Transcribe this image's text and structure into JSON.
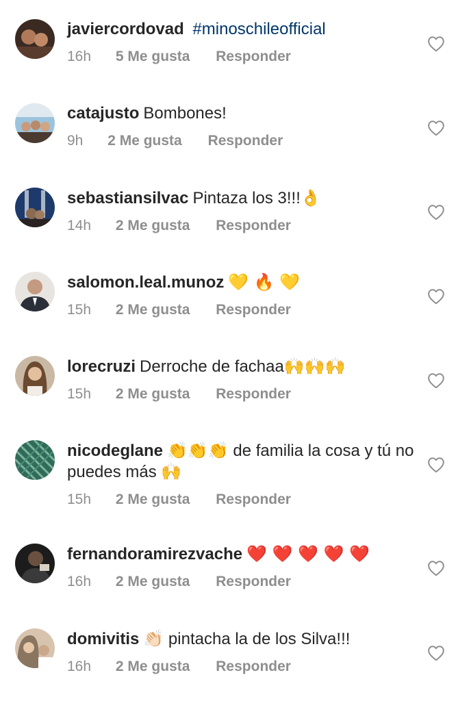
{
  "comments": [
    {
      "username": "javiercordovad",
      "text": "",
      "hashtag": "#minoschileofficial",
      "emoji": "",
      "text2": "",
      "time": "16h",
      "likes": "5 Me gusta",
      "reply": "Responder",
      "avatar_colors": [
        "#3a2a22",
        "#b07a5a"
      ]
    },
    {
      "username": "catajusto",
      "text": "Bombones!",
      "hashtag": "",
      "emoji": "",
      "text2": "",
      "time": "9h",
      "likes": "2 Me gusta",
      "reply": "Responder",
      "avatar_colors": [
        "#6fa6c9",
        "#c99a7c"
      ]
    },
    {
      "username": "sebastiansilvac",
      "text": "Pintaza los 3!!!",
      "hashtag": "",
      "emoji": "👌",
      "text2": "",
      "time": "14h",
      "likes": "2 Me gusta",
      "reply": "Responder",
      "avatar_colors": [
        "#1e3a6b",
        "#8a6a50"
      ]
    },
    {
      "username": "salomon.leal.munoz",
      "text": "",
      "hashtag": "",
      "emoji": "💛 🔥 💛",
      "text2": "",
      "time": "15h",
      "likes": "2 Me gusta",
      "reply": "Responder",
      "avatar_colors": [
        "#e8e4df",
        "#2a2f3a"
      ]
    },
    {
      "username": "lorecruzi",
      "text": "Derroche de fachaa",
      "hashtag": "",
      "emoji": "🙌🙌🙌",
      "text2": "",
      "time": "15h",
      "likes": "2 Me gusta",
      "reply": "Responder",
      "avatar_colors": [
        "#c9b8a4",
        "#6b4a30"
      ]
    },
    {
      "username": "nicodeglane",
      "text": "",
      "hashtag": "",
      "emoji": "👏👏👏",
      "text2": "de familia la cosa y tú no puedes más",
      "emoji2": "🙌",
      "time": "15h",
      "likes": "2 Me gusta",
      "reply": "Responder",
      "avatar_colors": [
        "#2f6b5a",
        "#7fb39a"
      ]
    },
    {
      "username": "fernandoramirezvache",
      "text": "",
      "hashtag": "",
      "emoji": "❤️ ❤️ ❤️ ❤️ ❤️",
      "text2": "",
      "time": "16h",
      "likes": "2 Me gusta",
      "reply": "Responder",
      "avatar_colors": [
        "#1c1c1c",
        "#6a5040"
      ]
    },
    {
      "username": "domivitis",
      "text": "",
      "hashtag": "",
      "emoji": "👏🏻",
      "text2": "pintacha la de los Silva!!!",
      "time": "16h",
      "likes": "2 Me gusta",
      "reply": "Responder",
      "avatar_colors": [
        "#8a7560",
        "#d8c4ae"
      ]
    }
  ],
  "colors": {
    "text": "#262626",
    "meta": "#8e8e8e",
    "hashtag": "#00376b",
    "heart": "#8e8e8e",
    "background": "#ffffff"
  },
  "icons": {
    "like": "heart-outline-icon"
  }
}
